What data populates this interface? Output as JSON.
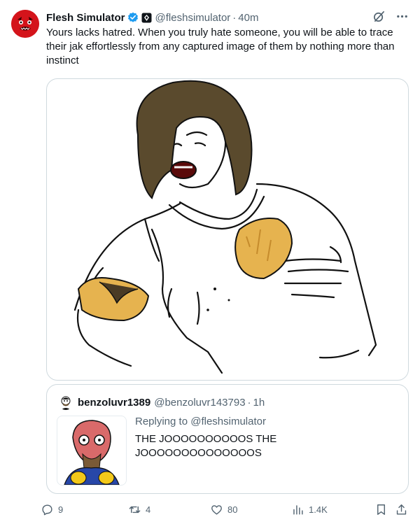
{
  "tweet": {
    "author_name": "Flesh Simulator",
    "handle": "@fleshsimulator",
    "separator": "·",
    "time": "40m",
    "text": "Yours lacks hatred. When you truly hate someone, you will be able to trace their jak effortlessly from any captured image of them by nothing more than instinct"
  },
  "quote": {
    "author_name": "benzoluvr1389",
    "handle": "@benzoluvr143793",
    "separator": "·",
    "time": "1h",
    "replying_to_label": "Replying to ",
    "replying_to_handle": "@fleshsimulator",
    "text": "THE JOOOOOOOOOOS THE JOOOOOOOOOOOOOOS"
  },
  "actions": {
    "replies": "9",
    "reposts": "4",
    "likes": "80",
    "views": "1.4K"
  },
  "colors": {
    "text": "#0f1419",
    "secondary": "#536471",
    "border": "#cfd9de",
    "verified": "#1d9bf0",
    "avatar_red": "#d4141b"
  },
  "icons": [
    "verified-badge-icon",
    "affiliate-badge-icon",
    "grok-icon",
    "more-icon",
    "reply-icon",
    "repost-icon",
    "like-icon",
    "views-icon",
    "bookmark-icon",
    "share-icon"
  ]
}
